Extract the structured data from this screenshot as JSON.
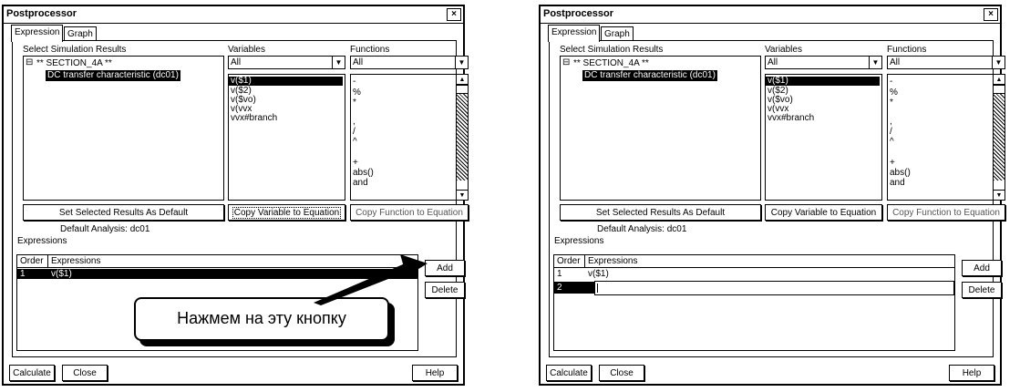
{
  "left_window": {
    "title": "Postprocessor",
    "close_glyph": "×",
    "tabs": [
      "Expression",
      "Graph"
    ],
    "select_results_label": "Select Simulation Results",
    "tree_root": "** SECTION_4A **",
    "tree_child": "DC transfer characteristic (dc01)",
    "variables_label": "Variables",
    "variables_combo": "All",
    "variables": [
      "v($1)",
      "v($2)",
      "v($vo)",
      "v(vvx",
      "vvx#branch"
    ],
    "functions_label": "Functions",
    "functions_combo": "All",
    "functions": [
      "-",
      "%",
      "*",
      ",",
      "/",
      "^",
      "+",
      "abs()",
      "and"
    ],
    "set_default_button": "Set Selected Results As Default",
    "copy_variable_button": "Copy Variable to Equation",
    "copy_function_button": "Copy Function to Equation",
    "default_analysis": "Default Analysis: dc01",
    "expressions_label": "Expressions",
    "columns": [
      "Order",
      "Expressions"
    ],
    "rows": [
      {
        "order": "1",
        "expr": "v($1)"
      }
    ],
    "add_button": "Add",
    "delete_button": "Delete",
    "calculate_button": "Calculate",
    "close_button": "Close",
    "help_button": "Help",
    "callout_text": "Нажмем на эту кнопку"
  },
  "right_window": {
    "title": "Postprocessor",
    "close_glyph": "×",
    "tabs": [
      "Expression",
      "Graph"
    ],
    "select_results_label": "Select Simulation Results",
    "tree_root": "** SECTION_4A **",
    "tree_child": "DC transfer characteristic (dc01)",
    "variables_label": "Variables",
    "variables_combo": "All",
    "variables": [
      "v($1)",
      "v($2)",
      "v($vo)",
      "v(vvx",
      "vvx#branch"
    ],
    "functions_label": "Functions",
    "functions_combo": "All",
    "functions": [
      "-",
      "%",
      "*",
      ",",
      "/",
      "^",
      "+",
      "abs()",
      "and"
    ],
    "set_default_button": "Set Selected Results As Default",
    "copy_variable_button": "Copy Variable to Equation",
    "copy_function_button": "Copy Function to Equation",
    "default_analysis": "Default Analysis: dc01",
    "expressions_label": "Expressions",
    "columns": [
      "Order",
      "Expressions"
    ],
    "rows": [
      {
        "order": "1",
        "expr": "v($1)"
      },
      {
        "order": "2",
        "expr": ""
      }
    ],
    "add_button": "Add",
    "delete_button": "Delete",
    "calculate_button": "Calculate",
    "close_button": "Close",
    "help_button": "Help"
  }
}
